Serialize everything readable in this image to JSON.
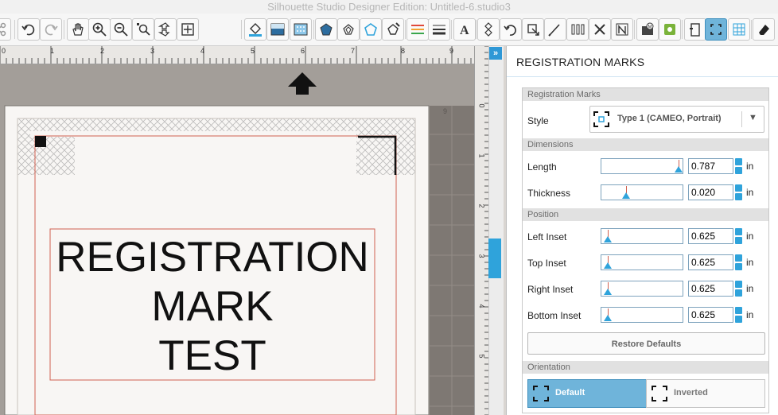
{
  "window": {
    "title": "Silhouette Studio Designer Edition: Untitled-6.studio3"
  },
  "canvas": {
    "text_lines": [
      "REGISTRATION",
      "MARK",
      "TEST"
    ],
    "top_ruler_numbers": [
      "0",
      "1",
      "2",
      "3",
      "4",
      "5",
      "6",
      "7",
      "8",
      "9"
    ],
    "side_ruler_numbers": [
      "0",
      "1",
      "2",
      "3",
      "4",
      "5"
    ],
    "inner_ruler_mark": "9"
  },
  "panel": {
    "title": "REGISTRATION MARKS",
    "collapse_glyph": "»",
    "sections": {
      "registration_marks": "Registration Marks",
      "dimensions": "Dimensions",
      "position": "Position",
      "orientation": "Orientation"
    },
    "style": {
      "label": "Style",
      "value": "Type 1 (CAMEO, Portrait)"
    },
    "dimensions": [
      {
        "label": "Length",
        "value": "0.787",
        "unit": "in",
        "slider_level": 0.95
      },
      {
        "label": "Thickness",
        "value": "0.020",
        "unit": "in",
        "slider_level": 0.3
      }
    ],
    "position": [
      {
        "label": "Left Inset",
        "value": "0.625",
        "unit": "in",
        "slider_level": 0.08
      },
      {
        "label": "Top Inset",
        "value": "0.625",
        "unit": "in",
        "slider_level": 0.08
      },
      {
        "label": "Right Inset",
        "value": "0.625",
        "unit": "in",
        "slider_level": 0.08
      },
      {
        "label": "Bottom Inset",
        "value": "0.625",
        "unit": "in",
        "slider_level": 0.08
      }
    ],
    "restore_defaults": "Restore Defaults",
    "orientation": {
      "default_label": "Default",
      "inverted_label": "Inverted",
      "selected": "Default"
    }
  },
  "colors": {
    "accent": "#2fa3db",
    "mark_red": "#d0604f",
    "selected_button": "#6fb4da"
  }
}
